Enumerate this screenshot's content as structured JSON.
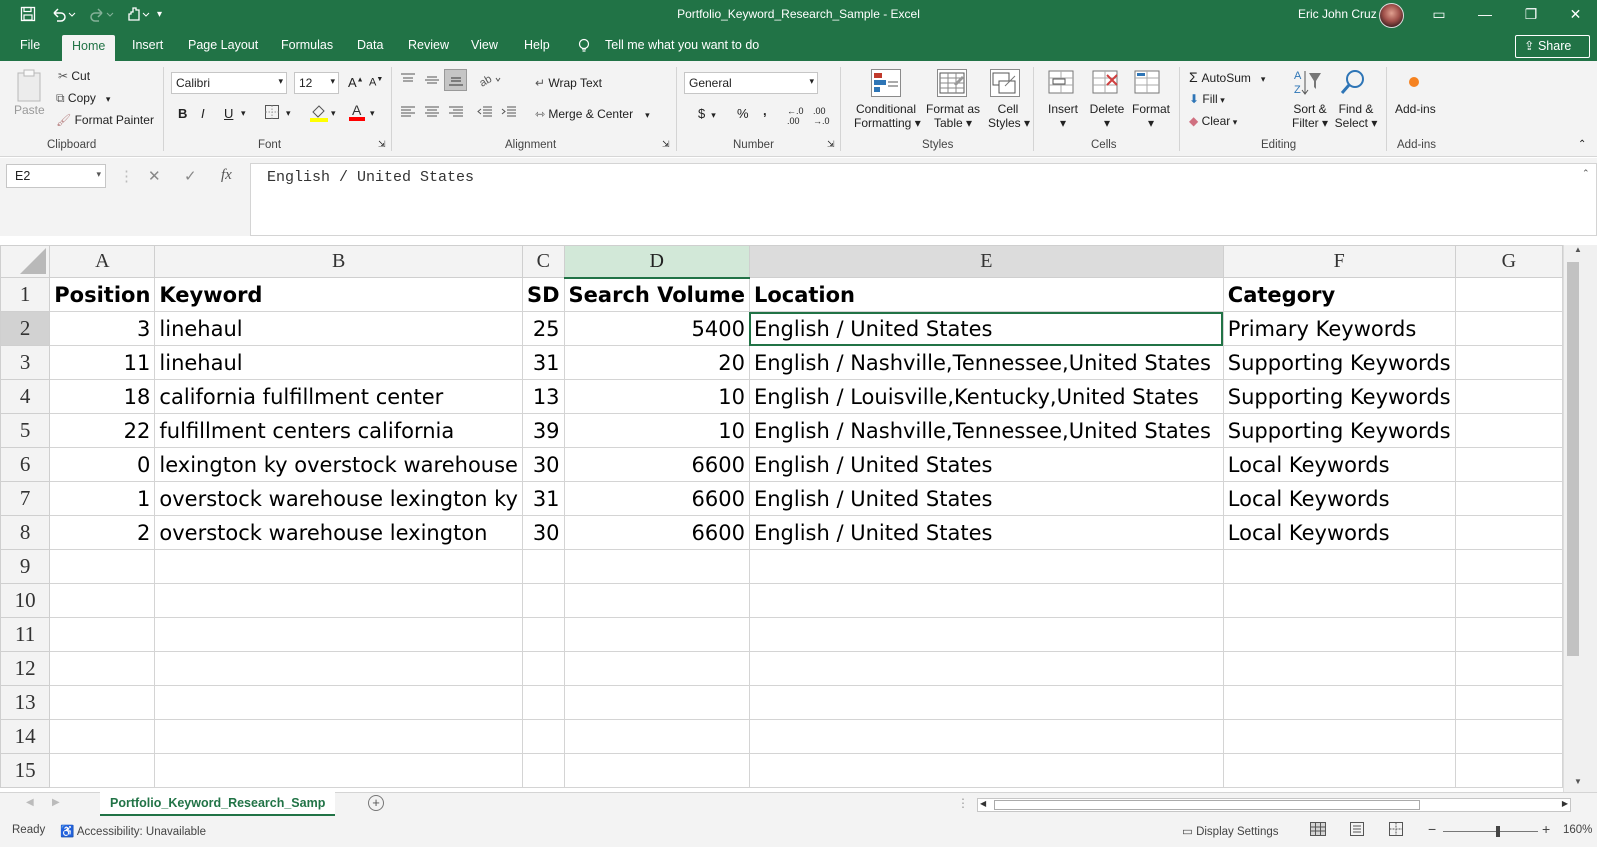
{
  "app": {
    "window_title": "Portfolio_Keyword_Research_Sample  -  Excel",
    "user": "Eric John Cruz",
    "colors": {
      "accent": "#217346",
      "selected_header": "#d2e8d8",
      "ribbon_bg": "#f3f3f3"
    }
  },
  "quick_access": {
    "icons": [
      "save-icon",
      "undo-icon",
      "redo-icon",
      "touch-mode-icon",
      "customize-icon"
    ]
  },
  "window_controls": {
    "icons": [
      "ribbon-display-icon",
      "minimize-icon",
      "maximize-icon",
      "close-icon"
    ],
    "glyphs": [
      "▭",
      "—",
      "❐",
      "✕"
    ]
  },
  "tabs": [
    {
      "label": "File",
      "active": false
    },
    {
      "label": "Home",
      "active": true
    },
    {
      "label": "Insert",
      "active": false
    },
    {
      "label": "Page Layout",
      "active": false
    },
    {
      "label": "Formulas",
      "active": false
    },
    {
      "label": "Data",
      "active": false
    },
    {
      "label": "Review",
      "active": false
    },
    {
      "label": "View",
      "active": false
    },
    {
      "label": "Help",
      "active": false
    }
  ],
  "tell_me": "Tell me what you want to do",
  "share_label": "Share",
  "ribbon": {
    "clipboard": {
      "paste": "Paste",
      "cut": "Cut",
      "copy": "Copy",
      "format_painter": "Format Painter",
      "group": "Clipboard"
    },
    "font": {
      "name": "Calibri",
      "size": "12",
      "bold": "B",
      "italic": "I",
      "underline": "U",
      "group": "Font"
    },
    "alignment": {
      "wrap_text": "Wrap Text",
      "merge_center": "Merge & Center",
      "group": "Alignment"
    },
    "number": {
      "format": "General",
      "currency": "$",
      "percent": "%",
      "comma": ",",
      "group": "Number"
    },
    "styles": {
      "conditional": "Conditional",
      "conditional2": "Formatting",
      "format_as": "Format as",
      "table": "Table",
      "cell": "Cell",
      "styles_label": "Styles",
      "group": "Styles"
    },
    "cells": {
      "insert": "Insert",
      "delete": "Delete",
      "format": "Format",
      "group": "Cells"
    },
    "editing": {
      "autosum": "AutoSum",
      "fill": "Fill",
      "clear": "Clear",
      "sort": "Sort &",
      "filter": "Filter",
      "find": "Find &",
      "select": "Select",
      "group": "Editing"
    },
    "addins": {
      "label": "Add-ins",
      "group": "Add-ins"
    }
  },
  "formula_bar": {
    "name_box": "E2",
    "formula": "English / United States",
    "fx": "fx"
  },
  "sheet": {
    "columns": [
      "A",
      "B",
      "C",
      "D",
      "E",
      "F",
      "G"
    ],
    "selected_column": "D",
    "active_cell": "E2",
    "row_numbers": [
      "1",
      "2",
      "3",
      "4",
      "5",
      "6",
      "7",
      "8",
      "9",
      "10",
      "11",
      "12",
      "13",
      "14",
      "15"
    ],
    "header_row": [
      "Position",
      "Keyword",
      "SD",
      "Search Volume",
      "Location",
      "Category",
      ""
    ],
    "rows": [
      [
        "3",
        "linehaul",
        "25",
        "5400",
        "English / United States",
        "Primary Keywords",
        ""
      ],
      [
        "11",
        "linehaul",
        "31",
        "20",
        "English / Nashville,Tennessee,United States",
        "Supporting Keywords",
        ""
      ],
      [
        "18",
        "california fulfillment center",
        "13",
        "10",
        "English / Louisville,Kentucky,United States",
        "Supporting Keywords",
        ""
      ],
      [
        "22",
        "fulfillment centers california",
        "39",
        "10",
        "English / Nashville,Tennessee,United States",
        "Supporting Keywords",
        ""
      ],
      [
        "0",
        "lexington ky overstock warehouse",
        "30",
        "6600",
        "English / United States",
        "Local Keywords",
        ""
      ],
      [
        "1",
        "overstock warehouse lexington ky",
        "31",
        "6600",
        "English / United States",
        "Local Keywords",
        ""
      ],
      [
        "2",
        "overstock warehouse lexington",
        "30",
        "6600",
        "English / United States",
        "Local Keywords",
        ""
      ]
    ]
  },
  "sheet_tab": "Portfolio_Keyword_Research_Samp",
  "status": {
    "ready": "Ready",
    "accessibility": "Accessibility: Unavailable",
    "display_settings": "Display Settings",
    "zoom": "160%"
  }
}
